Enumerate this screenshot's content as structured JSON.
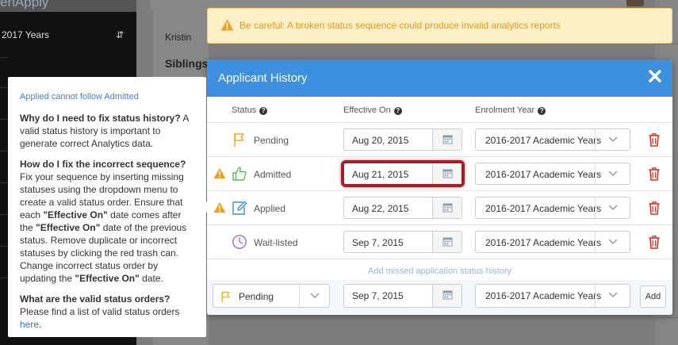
{
  "app": {
    "logo_text": "enApply",
    "year_selector": "2017 Years",
    "student_name": "Kristin",
    "siblings_heading": "Siblings"
  },
  "warning_banner": {
    "text": "Be careful: A broken status sequence could produce invalid analytics reports",
    "color": "#d89a1c"
  },
  "modal": {
    "title": "Applicant History",
    "header_color": "#3d8fe0",
    "columns": {
      "status": "Status",
      "effective_on": "Effective On",
      "enrolment_year": "Enrolment Year"
    },
    "rows": [
      {
        "status": "Pending",
        "icon": "flag-icon",
        "date": "Aug 20, 2015",
        "year": "2016-2017 Academic Years",
        "warning": false,
        "highlighted": false
      },
      {
        "status": "Admitted",
        "icon": "thumbs-up-icon",
        "date": "Aug 21, 2015",
        "year": "2016-2017 Academic Years",
        "warning": true,
        "highlighted": true
      },
      {
        "status": "Applied",
        "icon": "edit-icon",
        "date": "Aug 22, 2015",
        "year": "2016-2017 Academic Years",
        "warning": true,
        "highlighted": false
      },
      {
        "status": "Wait-listed",
        "icon": "clock-icon",
        "date": "Sep 7, 2015",
        "year": "2016-2017 Academic Years",
        "warning": false,
        "highlighted": false
      }
    ],
    "add_missed_text": "Add missed application status history",
    "new_entry": {
      "status": "Pending",
      "date": "Sep 7, 2015",
      "year": "2016-2017 Academic Years",
      "add_label": "Add"
    }
  },
  "tooltip": {
    "title": "Applied cannot follow Admitted",
    "q1": "Why do I need to fix status history?",
    "a1": " A valid status history is important to generate correct Analytics data.",
    "q2": "How do I fix the incorrect sequence?",
    "a2_part1": " Fix your sequence by inserting missing statuses using the dropdown menu to create a valid status order. Ensure that each ",
    "effective_on": "\"Effective On\"",
    "a2_part2": " date comes after the ",
    "a2_part3": " date of the previous status. Remove duplicate or incorrect statuses by clicking the red trash can. Change incorrect status order by updating the ",
    "a2_part4": " date.",
    "q3": "What are the valid status orders?",
    "a3": " Please find a list of valid status orders ",
    "link": "here",
    "a3_end": "."
  },
  "colors": {
    "warning": "#f0a020",
    "trash": "#d9342b",
    "highlight": "#a31e27"
  }
}
